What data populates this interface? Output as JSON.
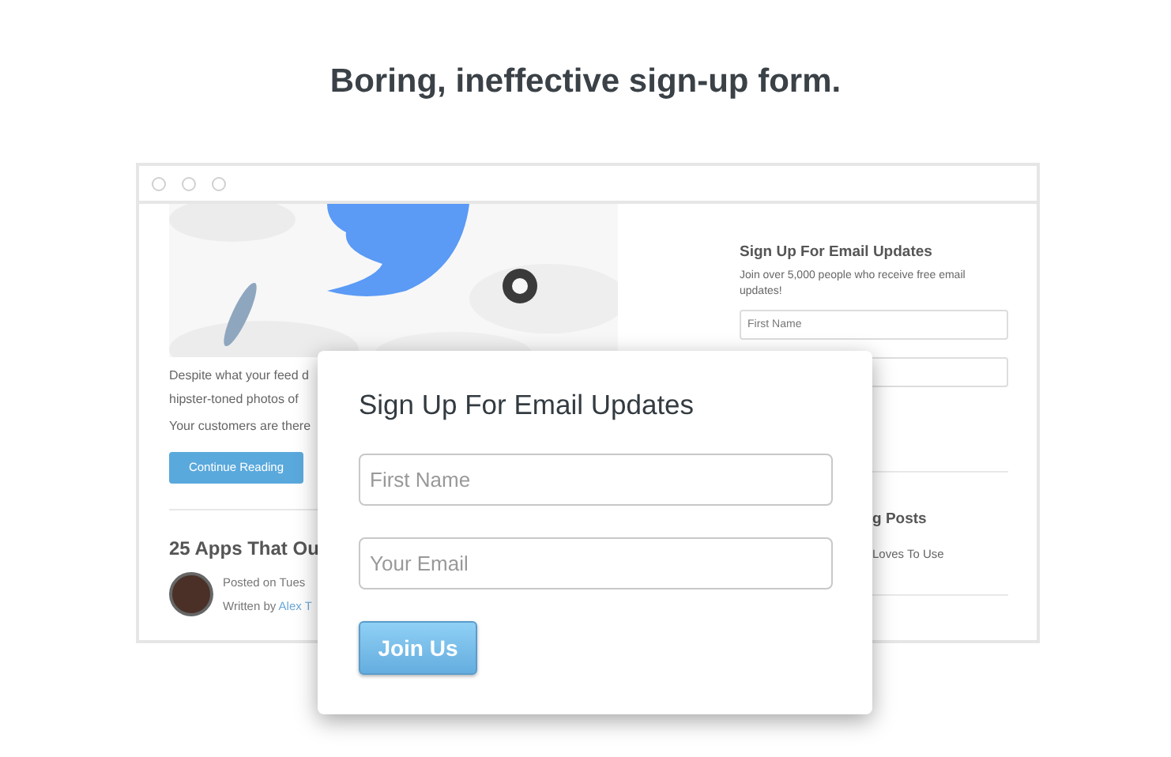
{
  "heading": "Boring, ineffective sign-up form.",
  "background_page": {
    "article": {
      "excerpt_lines": [
        "Despite what your feed d",
        "hipster-toned photos of"
      ],
      "note": "Your customers are there",
      "button": "Continue Reading",
      "next_title": "25 Apps That Ou",
      "posted": "Posted on Tues",
      "written_by": "Written by",
      "author": "Alex T"
    },
    "sidebar": {
      "title": "Sign Up For Email Updates",
      "text": "Join over 5,000 people who receive free email updates!",
      "fields": [
        {
          "placeholder": "First Name"
        }
      ],
      "posts_heading": "g Posts",
      "post": "Loves To Use"
    }
  },
  "modal": {
    "title": "Sign Up For Email Updates",
    "fields": [
      {
        "placeholder": "First Name"
      },
      {
        "placeholder": "Your Email"
      }
    ],
    "button": "Join Us"
  }
}
